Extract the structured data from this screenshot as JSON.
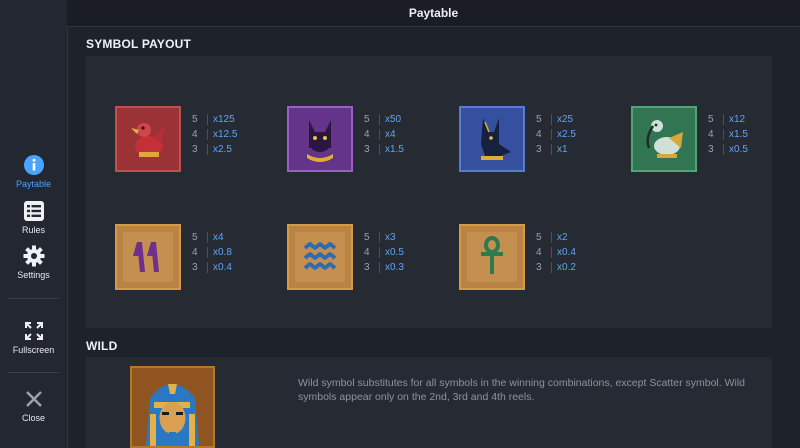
{
  "header": {
    "title": "Paytable"
  },
  "sidebar": {
    "items": [
      {
        "label": "Paytable",
        "icon": "info-icon",
        "active": true
      },
      {
        "label": "Rules",
        "icon": "list-icon"
      },
      {
        "label": "Settings",
        "icon": "gear-icon"
      },
      {
        "label": "Fullscreen",
        "icon": "fullscreen-icon"
      },
      {
        "label": "Close",
        "icon": "close-icon"
      }
    ]
  },
  "sections": {
    "symbol_payout": "SYMBOL PAYOUT",
    "wild": "WILD"
  },
  "symbols": [
    {
      "name": "red-falcon",
      "pays": [
        [
          "5",
          "x125"
        ],
        [
          "4",
          "x12.5"
        ],
        [
          "3",
          "x2.5"
        ]
      ]
    },
    {
      "name": "purple-cat",
      "pays": [
        [
          "5",
          "x50"
        ],
        [
          "4",
          "x4"
        ],
        [
          "3",
          "x1.5"
        ]
      ]
    },
    {
      "name": "blue-anubis",
      "pays": [
        [
          "5",
          "x25"
        ],
        [
          "4",
          "x2.5"
        ],
        [
          "3",
          "x1"
        ]
      ]
    },
    {
      "name": "green-ibis",
      "pays": [
        [
          "5",
          "x12"
        ],
        [
          "4",
          "x1.5"
        ],
        [
          "3",
          "x0.5"
        ]
      ]
    },
    {
      "name": "feather-glyph",
      "pays": [
        [
          "5",
          "x4"
        ],
        [
          "4",
          "x0.8"
        ],
        [
          "3",
          "x0.4"
        ]
      ]
    },
    {
      "name": "water-glyph",
      "pays": [
        [
          "5",
          "x3"
        ],
        [
          "4",
          "x0.5"
        ],
        [
          "3",
          "x0.3"
        ]
      ]
    },
    {
      "name": "ankh-glyph",
      "pays": [
        [
          "5",
          "x2"
        ],
        [
          "4",
          "x0.4"
        ],
        [
          "3",
          "x0.2"
        ]
      ]
    }
  ],
  "wild": {
    "description": "Wild symbol substitutes for all symbols in the winning combinations, except Scatter symbol. Wild symbols appear only on the 2nd, 3rd and 4th reels."
  },
  "colors": {
    "accent": "#4aa3ff",
    "multiplier": "#5fa6f2",
    "background": "#1e222b",
    "panel": "#262a33"
  }
}
